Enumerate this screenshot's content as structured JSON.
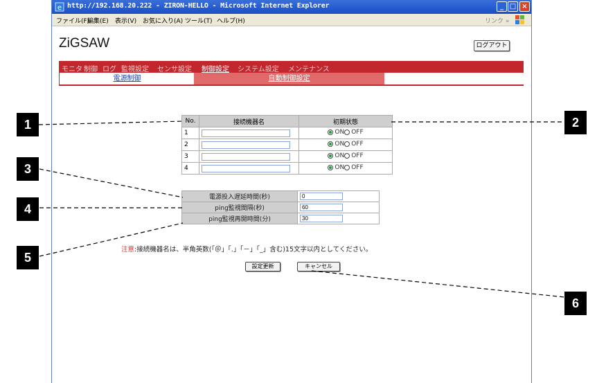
{
  "browser": {
    "title": "http://192.168.20.222 - ZIRON-HELLO - Microsoft Internet Explorer",
    "menu": [
      "ファイル(F)",
      "編集(E)",
      "表示(V)",
      "お気に入り(A)",
      "ツール(T)",
      "ヘルプ(H)"
    ],
    "links_label": "リンク »"
  },
  "page": {
    "logo": "ZiGSAW",
    "logout_label": "ログアウト",
    "tabs": [
      "モニタ",
      "制御",
      "ログ",
      "監視設定",
      "センサ設定",
      "制御設定",
      "システム設定",
      "メンテナンス"
    ],
    "selected_tab": "制御設定",
    "subtabs": [
      "電源制御",
      "自動制御設定"
    ]
  },
  "device_table": {
    "headers": [
      "No.",
      "接続機器名",
      "初期状態"
    ],
    "on_label": "ON",
    "off_label": "OFF",
    "rows": [
      {
        "no": "1",
        "name": "",
        "state": "ON"
      },
      {
        "no": "2",
        "name": "",
        "state": "ON"
      },
      {
        "no": "3",
        "name": "",
        "state": "ON"
      },
      {
        "no": "4",
        "name": "",
        "state": "ON"
      }
    ]
  },
  "settings": [
    {
      "label": "電源投入遅延時間(秒)",
      "value": "0"
    },
    {
      "label": "ping監視間隔(秒)",
      "value": "60"
    },
    {
      "label": "ping監視再開時間(分)",
      "value": "30"
    }
  ],
  "note": {
    "head": "注意",
    "body": ":接続機器名は、半角英数(「＠」「.」「－」「_」含む)15文字以内としてください。"
  },
  "buttons": {
    "update": "設定更新",
    "cancel": "キャンセル"
  },
  "callouts": [
    "1",
    "2",
    "3",
    "4",
    "5",
    "6"
  ]
}
